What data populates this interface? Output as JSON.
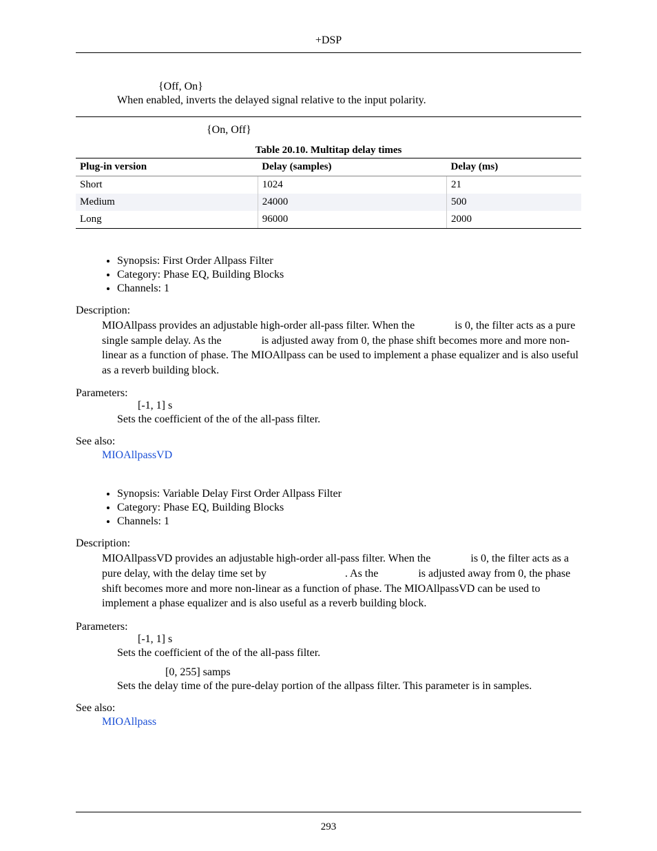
{
  "header": "+DSP",
  "intro": {
    "offon": "{Off, On}",
    "line": "When enabled, inverts the delayed signal relative to the input polarity.",
    "onoff": "{On, Off}"
  },
  "table": {
    "caption": "Table 20.10. Multitap delay times",
    "headers": [
      "Plug-in version",
      "Delay (samples)",
      "Delay (ms)"
    ],
    "rows": [
      [
        "Short",
        "1024",
        "21"
      ],
      [
        "Medium",
        "24000",
        "500"
      ],
      [
        "Long",
        "96000",
        "2000"
      ]
    ]
  },
  "sec1": {
    "synopsis": "Synopsis: First Order Allpass Filter",
    "category": "Category: Phase EQ, Building Blocks",
    "channels": "Channels: 1",
    "descLabel": "Description:",
    "descP1a": "MIOAllpass provides an adjustable high-order all-pass filter. When the ",
    "descP1b": " is 0, the filter acts as a pure single sample delay. As the ",
    "descP1c": " is adjusted away from 0, the phase shift becomes more and more non-linear as a function of phase. The MIOAllpass can be used to implement a phase equalizer and is also useful as a reverb building block.",
    "paramsLabel": "Parameters:",
    "paramRange": "[-1, 1] s",
    "paramText": "Sets the coefficient of the of the all-pass filter.",
    "seeAlsoLabel": "See also:",
    "seeAlsoLink": "MIOAllpassVD"
  },
  "sec2": {
    "synopsis": "Synopsis: Variable Delay First Order Allpass Filter",
    "category": "Category: Phase EQ, Building Blocks",
    "channels": "Channels: 1",
    "descLabel": "Description:",
    "descP1a": "MIOAllpassVD provides an adjustable high-order all-pass filter. When the ",
    "descP1b": " is 0, the filter acts as a pure delay, with the delay time set by ",
    "descP1c": ". As the ",
    "descP1d": " is adjusted away from 0, the phase shift becomes more and more non-linear as a function of phase. The MIOAllpassVD can be used to implement a phase equalizer and is also useful as a reverb building block.",
    "paramsLabel": "Parameters:",
    "paramRange1": "[-1, 1] s",
    "paramText1": "Sets the coefficient of the of the all-pass filter.",
    "paramRange2": "[0, 255] samps",
    "paramText2": "Sets the delay time of the pure-delay portion of the allpass filter. This parameter is in samples.",
    "seeAlsoLabel": "See also:",
    "seeAlsoLink": "MIOAllpass"
  },
  "pageNumber": "293"
}
